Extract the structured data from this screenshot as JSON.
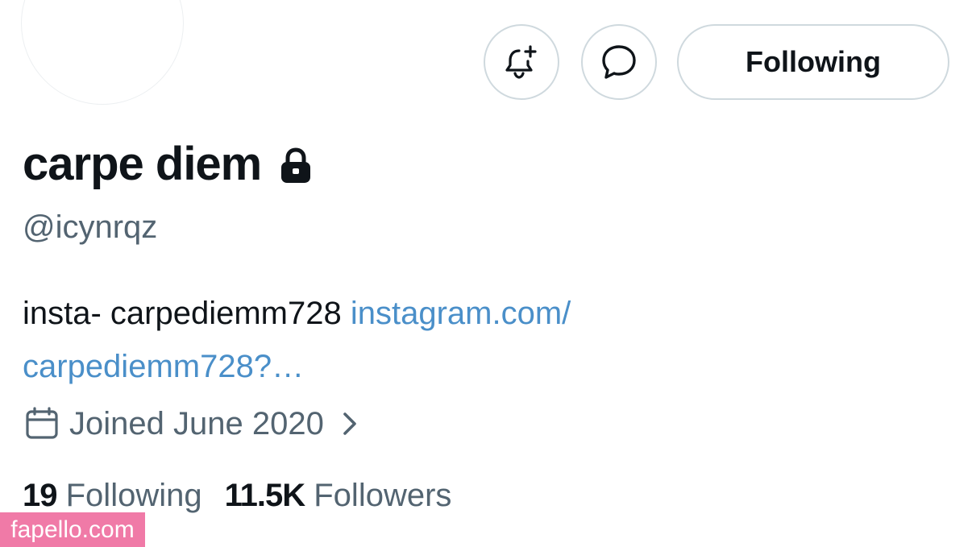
{
  "profile": {
    "display_name": "carpe diem",
    "handle": "@icynrqz",
    "bio_text": "insta- carpediemm728 ",
    "bio_link_line1": "instagram.com/",
    "bio_link_line2": "carpediemm728?…",
    "joined": "Joined June 2020",
    "following_count": "19",
    "following_label": "Following",
    "followers_count": "11.5K",
    "followers_label": "Followers"
  },
  "actions": {
    "follow_label": "Following",
    "notify_icon": "bell-plus-icon",
    "message_icon": "message-bubble-icon"
  },
  "icons": {
    "lock": "lock-icon",
    "calendar": "calendar-icon",
    "chevron": "chevron-right-icon"
  },
  "colors": {
    "text_primary": "#0f1419",
    "text_secondary": "#536471",
    "link": "#4a8fc9",
    "border": "#cfd9de",
    "watermark_bg": "#f07aa7"
  },
  "watermark": {
    "text": "fapello.com"
  }
}
